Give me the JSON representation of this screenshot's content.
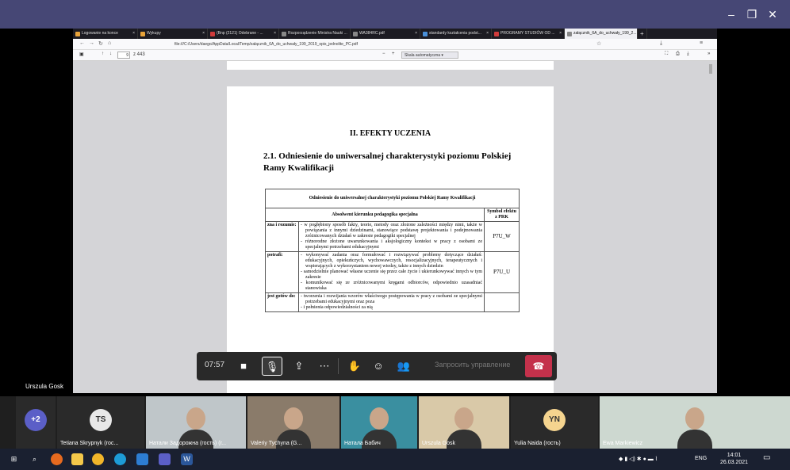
{
  "window": {
    "minimize": "–",
    "maximize": "❐",
    "close": "✕"
  },
  "browser": {
    "tabs": [
      {
        "label": "Logowanie na konce",
        "color": "#e8a33a"
      },
      {
        "label": "Wykupy",
        "color": "#e8a33a"
      },
      {
        "label": "(Bnp (2121) Odebrane - ...",
        "color": "#d03b3b"
      },
      {
        "label": "Rozporządzenie Ministra Nauki ...",
        "color": "#888888"
      },
      {
        "label": "WA384RC.pdf",
        "color": "#888888"
      },
      {
        "label": "standardy kształcenia podst...",
        "color": "#4a90d9"
      },
      {
        "label": "PROGRAMY STUDIÓW OD ...",
        "color": "#d03b3b"
      },
      {
        "label": "załącznik_6A_do_uchwały_199_2...",
        "color": "#888888"
      }
    ],
    "url": "file:///C:/Users/daego/AppData/Local/Temp/załącznik_6A_do_uchwały_199_2019_opis_jednolite_PC.pdf",
    "page_number": "9",
    "page_total": "z 443",
    "zoom_label": "Skala automatyczna"
  },
  "document": {
    "heading": "II. EFEKTY UCZENIA",
    "subheading": "2.1. Odniesienie do uniwersalnej charakterystyki poziomu Polskiej Ramy Kwalifikacji",
    "table": {
      "title": "Odniesienie do uniwersalnej charakterystyki poziomu Polskiej Ramy Kwalifikacji",
      "col_header": "Absolwent kierunku pedagogika specjalna",
      "symbol_header": "Symbol efektu z PRK",
      "rows": [
        {
          "category": "zna i rozumie:",
          "symbol": "P7U_W",
          "items": [
            "w pogłębiony sposób fakty, teorie, metody oraz złożone zależności między nimi, także w powiązania z innymi dziedzinami, stanowiące podstawę projektowania i podejmowania zróżnicowanych działań w zakresie pedagogiki specjalnej",
            "różnorodne złożone uwarunkowania i aksjologiczny kontekst w pracy z osobami ze specjalnymi potrzebami edukacyjnymi"
          ]
        },
        {
          "category": "potrafi:",
          "symbol": "P7U_U",
          "items": [
            "wykonywać zadania oraz formułować i rozwiązywać problemy dotyczące działań: edukacyjnych, opiekuńczych, wychowawczych, resocjalizacyjnych, terapeutycznych i wspierających z wykorzystaniem nowej wiedzy, także z innych dziedzin",
            "samodzielnie planować własne uczenie się przez całe życie i ukierunkowywać innych w tym zakresie",
            "komunikować się ze zróżnicowanymi kręgami odbiorców, odpowiednio uzasadniać stanowiska"
          ]
        },
        {
          "category": "jest gotów do:",
          "symbol": "",
          "items": [
            "tworzenia i rozwijania wzorów właściwego postępowania w pracy z osobami ze specjalnymi potrzebami edukacyjnymi oraz poza",
            "i pełnienia odpowiedzialności za nią"
          ]
        }
      ]
    }
  },
  "call": {
    "timer": "07:57",
    "request_control": "Запросить управление",
    "presenter": "Urszula Gosk"
  },
  "participants": [
    {
      "name": "",
      "initials": "+2",
      "avatar_color": "#5b5fc7"
    },
    {
      "name": "Tetiana Skrypnyk (гос...",
      "initials": "TS",
      "avatar_color": "#e8e8e8"
    },
    {
      "name": "Натали Задорожна (гость) (г...",
      "initials": "",
      "avatar_color": ""
    },
    {
      "name": "Valeriy Tychyna (G...",
      "initials": "",
      "avatar_color": ""
    },
    {
      "name": "Натала Бабич",
      "initials": "",
      "avatar_color": ""
    },
    {
      "name": "Urszula Gosk",
      "initials": "",
      "avatar_color": ""
    },
    {
      "name": "Yulia Naida (гость)",
      "initials": "YN",
      "avatar_color": "#f5d48f"
    },
    {
      "name": "Ewa Markiewicz",
      "initials": "",
      "avatar_color": ""
    }
  ],
  "taskbar": {
    "lang": "ENG",
    "time": "14:01",
    "date": "26.03.2021"
  }
}
